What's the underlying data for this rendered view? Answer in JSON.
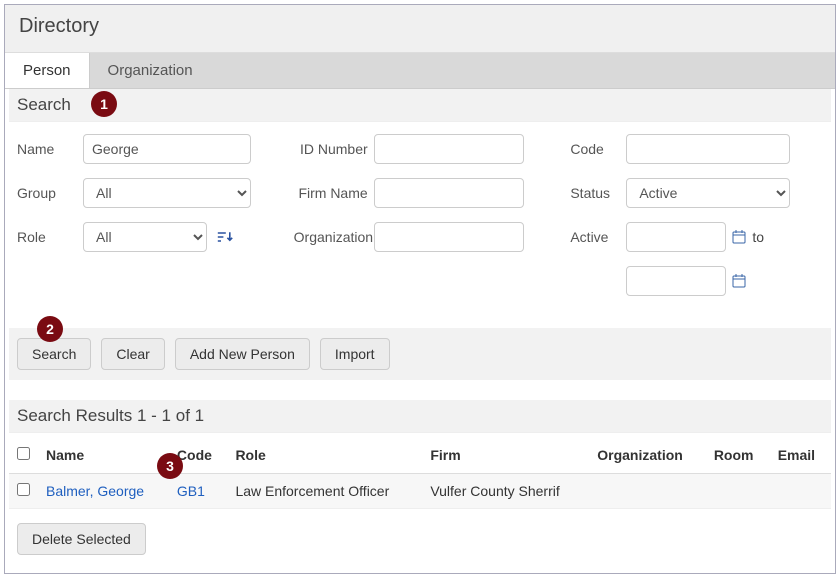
{
  "window_title": "Directory",
  "tabs": {
    "person": "Person",
    "organization": "Organization"
  },
  "search": {
    "heading": "Search",
    "labels": {
      "name": "Name",
      "group": "Group",
      "role": "Role",
      "id_number": "ID Number",
      "firm_name": "Firm Name",
      "organization": "Organization",
      "code": "Code",
      "status": "Status",
      "active": "Active",
      "to": "to"
    },
    "values": {
      "name": "George",
      "group": "All",
      "role": "All",
      "id_number": "",
      "firm_name": "",
      "organization": "",
      "code": "",
      "status": "Active",
      "active_from": "",
      "active_to": ""
    },
    "buttons": {
      "search": "Search",
      "clear": "Clear",
      "add_new": "Add New Person",
      "import": "Import"
    }
  },
  "results": {
    "heading": "Search Results 1 - 1 of 1",
    "columns": {
      "name": "Name",
      "code": "Code",
      "role": "Role",
      "firm": "Firm",
      "organization": "Organization",
      "room": "Room",
      "email": "Email"
    },
    "rows": [
      {
        "name": "Balmer, George",
        "code": "GB1",
        "role": "Law Enforcement Officer",
        "firm": "Vulfer County Sherrif",
        "organization": "",
        "room": "",
        "email": ""
      }
    ],
    "delete_button": "Delete Selected"
  },
  "annotations": {
    "1": "1",
    "2": "2",
    "3": "3"
  }
}
